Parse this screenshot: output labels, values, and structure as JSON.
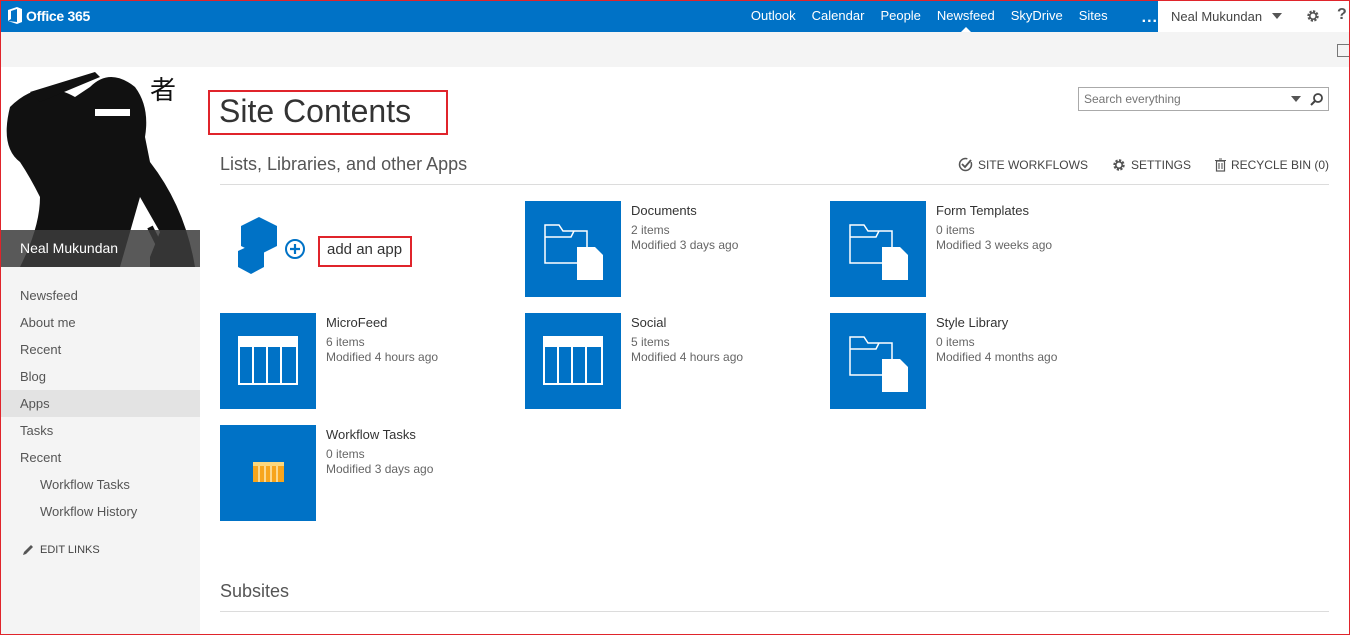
{
  "suite": {
    "brand": "Office 365",
    "nav": [
      {
        "label": "Outlook"
      },
      {
        "label": "Calendar"
      },
      {
        "label": "People"
      },
      {
        "label": "Newsfeed",
        "active": true
      },
      {
        "label": "SkyDrive"
      },
      {
        "label": "Sites"
      }
    ],
    "more": "...",
    "user": "Neal Mukundan",
    "help": "?"
  },
  "profile": {
    "name": "Neal Mukundan",
    "kanji": "者"
  },
  "quicklaunch": [
    {
      "label": "Newsfeed"
    },
    {
      "label": "About me"
    },
    {
      "label": "Recent"
    },
    {
      "label": "Blog"
    },
    {
      "label": "Apps",
      "selected": true
    },
    {
      "label": "Tasks"
    },
    {
      "label": "Recent"
    },
    {
      "label": "Workflow Tasks",
      "sub": true
    },
    {
      "label": "Workflow History",
      "sub": true
    }
  ],
  "edit_links": "EDIT LINKS",
  "page": {
    "title": "Site Contents",
    "search_placeholder": "Search everything",
    "section_heading": "Lists, Libraries, and other Apps",
    "actions": {
      "site_workflows": "SITE WORKFLOWS",
      "settings": "SETTINGS",
      "recycle_bin": "RECYCLE BIN (0)"
    },
    "add_app": "add an app",
    "subsites_heading": "Subsites"
  },
  "apps": [
    {
      "title": "Documents",
      "items": "2 items",
      "modified": "Modified 3 days ago",
      "icon": "folder-doc-icon"
    },
    {
      "title": "Form Templates",
      "items": "0 items",
      "modified": "Modified 3 weeks ago",
      "icon": "folder-doc-icon"
    },
    {
      "title": "MicroFeed",
      "items": "6 items",
      "modified": "Modified 4 hours ago",
      "icon": "list-grid-icon"
    },
    {
      "title": "Social",
      "items": "5 items",
      "modified": "Modified 4 hours ago",
      "icon": "list-grid-icon"
    },
    {
      "title": "Style Library",
      "items": "0 items",
      "modified": "Modified 4 months ago",
      "icon": "folder-doc-icon"
    },
    {
      "title": "Workflow Tasks",
      "items": "0 items",
      "modified": "Modified 3 days ago",
      "icon": "task-list-icon"
    }
  ],
  "colors": {
    "brand_blue": "#0072c6",
    "highlight_red": "#e0242b",
    "task_orange": "#f7a51d"
  }
}
